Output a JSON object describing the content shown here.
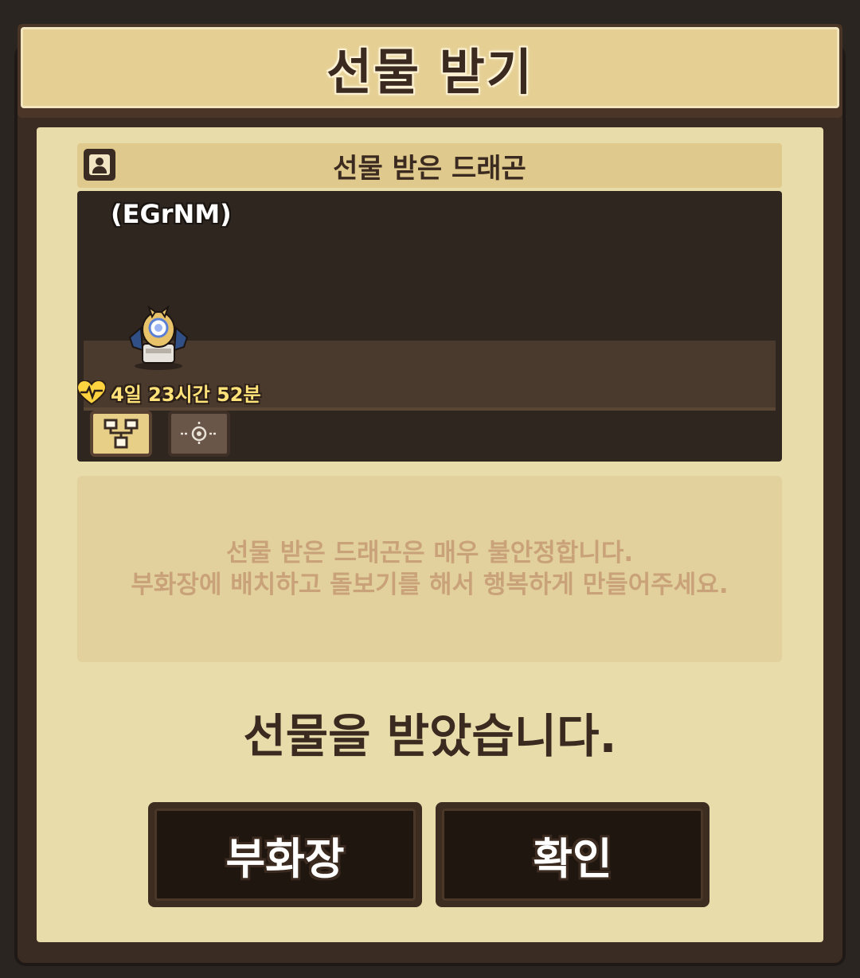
{
  "dialog": {
    "title": "선물 받기",
    "section_title": "선물 받은 드래곤",
    "dragon_name": "(EGrNM)",
    "timer": "4일 23시간 52분",
    "info_lines": [
      "선물 받은 드래곤은 매우 불안정합니다.",
      "부화장에 배치하고 돌보기를 해서 행복하게 만들어주세요."
    ],
    "result_message": "선물을 받았습니다.",
    "buttons": {
      "hatchery": "부화장",
      "confirm": "확인"
    }
  },
  "colors": {
    "panel_bg": "#e9dcab",
    "title_plate": "#e5cf93",
    "viewer_bg": "#2f2620",
    "timer_text": "#ffe27a",
    "info_text": "#c9a27a",
    "button_face": "#1f1610"
  },
  "icons": {
    "section": "portrait-icon",
    "timer": "heart-pulse-icon",
    "tool_active": "tree-structure-icon",
    "tool_inactive": "target-icon"
  }
}
